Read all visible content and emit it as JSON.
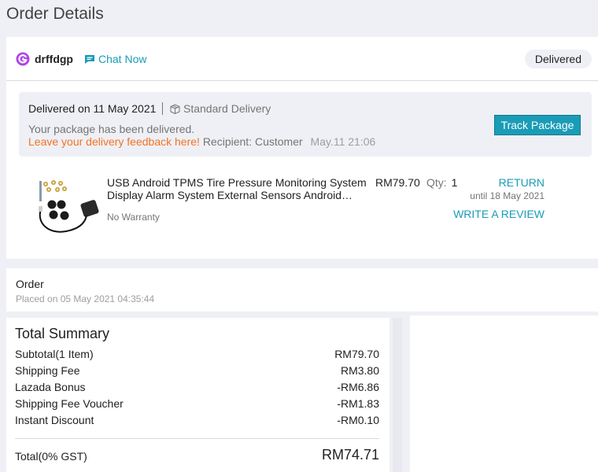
{
  "page": {
    "title": "Order Details"
  },
  "shop": {
    "name": "drffdgp",
    "chat_label": "Chat Now",
    "status": "Delivered"
  },
  "delivery": {
    "date_text": "Delivered on 11 May 2021",
    "method": "Standard Delivery",
    "message": "Your package has been delivered.",
    "feedback_link": "Leave your delivery feedback here!",
    "recipient": "Recipient: Customer",
    "time": "May.11 21:06",
    "track_button": "Track Package"
  },
  "item": {
    "title": "USB Android TPMS Tire Pressure Monitoring System Display Alarm System External Sensors Android Navigation",
    "warranty": "No Warranty",
    "price": "RM79.70",
    "qty_label": "Qty:",
    "qty_value": "1",
    "return_label": "RETURN",
    "return_until": "until 18 May 2021",
    "review_label": "WRITE A REVIEW"
  },
  "order": {
    "label": "Order",
    "placed_on": "Placed on 05 May 2021 04:35:44"
  },
  "summary": {
    "title": "Total Summary",
    "rows": [
      {
        "label": "Subtotal(1 Item)",
        "value": "RM79.70"
      },
      {
        "label": "Shipping Fee",
        "value": "RM3.80"
      },
      {
        "label": "Lazada Bonus",
        "value": "-RM6.86"
      },
      {
        "label": "Shipping Fee Voucher",
        "value": "-RM1.83"
      },
      {
        "label": "Instant Discount",
        "value": "-RM0.10"
      }
    ],
    "total_label": "Total(0% GST)",
    "total_value": "RM74.71"
  },
  "colors": {
    "accent": "#1a9cb7",
    "feedback": "#f57224",
    "background": "#eff0f5"
  },
  "icons": {
    "shop": "lazmall-shop-icon",
    "chat": "chat-bubble-icon",
    "delivery": "package-box-icon"
  }
}
